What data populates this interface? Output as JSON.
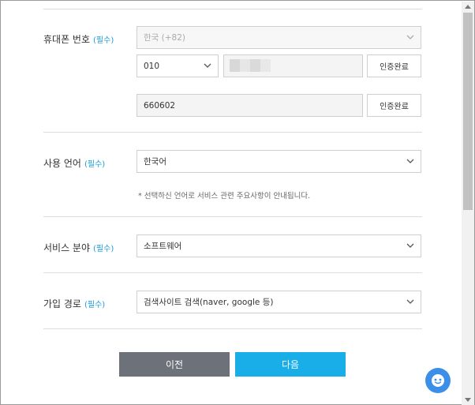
{
  "phone": {
    "label": "휴대폰 번호",
    "required": "(필수)",
    "country_value": "한국 (+82)",
    "prefix_value": "010",
    "verify1_label": "인증완료",
    "code_value": "660602",
    "verify2_label": "인증완료"
  },
  "language": {
    "label": "사용 언어",
    "required": "(필수)",
    "value": "한국어",
    "note": "* 선택하신 언어로 서비스 관련 주요사항이 안내됩니다."
  },
  "service": {
    "label": "서비스 분야",
    "required": "(필수)",
    "value": "소프트웨어"
  },
  "signup": {
    "label": "가입 경로",
    "required": "(필수)",
    "value": "검색사이트 검색(naver, google 등)"
  },
  "buttons": {
    "prev_label": "이전",
    "next_label": "다음"
  },
  "colors": {
    "accent": "#19aee8",
    "secondary": "#6d717a",
    "required": "#1a9ad6"
  }
}
